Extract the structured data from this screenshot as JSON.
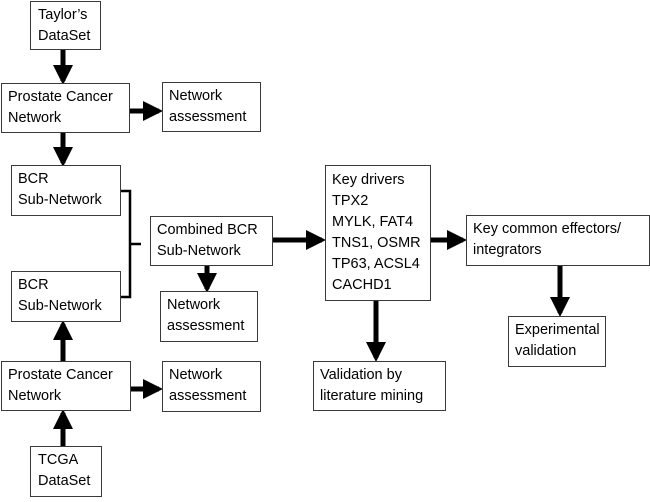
{
  "diagram": {
    "nodes": {
      "taylor": {
        "lines": [
          "Taylor’s",
          "DataSet"
        ]
      },
      "pcn_top": {
        "lines": [
          "Prostate Cancer",
          "Network"
        ]
      },
      "na_top": {
        "lines": [
          "Network",
          "assessment"
        ]
      },
      "bcr_top": {
        "lines": [
          "BCR",
          "Sub-Network"
        ]
      },
      "bcr_bottom": {
        "lines": [
          "BCR",
          "Sub-Network"
        ]
      },
      "combined": {
        "lines": [
          "Combined BCR",
          "Sub-Network"
        ]
      },
      "na_mid": {
        "lines": [
          "Network",
          "assessment"
        ]
      },
      "key_drivers": {
        "lines": [
          "Key drivers",
          "TPX2",
          "MYLK, FAT4",
          "TNS1, OSMR",
          "TP63, ACSL4",
          "CACHD1"
        ]
      },
      "effectors": {
        "lines": [
          "Key common effectors/",
          "integrators"
        ]
      },
      "experimental": {
        "lines": [
          "Experimental",
          "validation"
        ]
      },
      "literature": {
        "lines": [
          "Validation by",
          "literature mining"
        ]
      },
      "pcn_bottom": {
        "lines": [
          "Prostate Cancer",
          "Network"
        ]
      },
      "na_bottom": {
        "lines": [
          "Network",
          "assessment"
        ]
      },
      "tcga": {
        "lines": [
          "TCGA",
          "DataSet"
        ]
      }
    },
    "edges": [
      {
        "from": "taylor",
        "to": "pcn_top"
      },
      {
        "from": "pcn_top",
        "to": "na_top"
      },
      {
        "from": "pcn_top",
        "to": "bcr_top"
      },
      {
        "from": "bcr_top",
        "to": "combined",
        "style": "bracket"
      },
      {
        "from": "bcr_bottom",
        "to": "combined",
        "style": "bracket"
      },
      {
        "from": "combined",
        "to": "key_drivers"
      },
      {
        "from": "combined",
        "to": "na_mid"
      },
      {
        "from": "key_drivers",
        "to": "effectors"
      },
      {
        "from": "key_drivers",
        "to": "literature"
      },
      {
        "from": "effectors",
        "to": "experimental"
      },
      {
        "from": "pcn_bottom",
        "to": "na_bottom"
      },
      {
        "from": "pcn_bottom",
        "to": "bcr_bottom"
      },
      {
        "from": "tcga",
        "to": "pcn_bottom"
      }
    ],
    "colors": {
      "stroke": "#000000",
      "box_border": "#3a3a3a",
      "background": "#ffffff"
    }
  }
}
